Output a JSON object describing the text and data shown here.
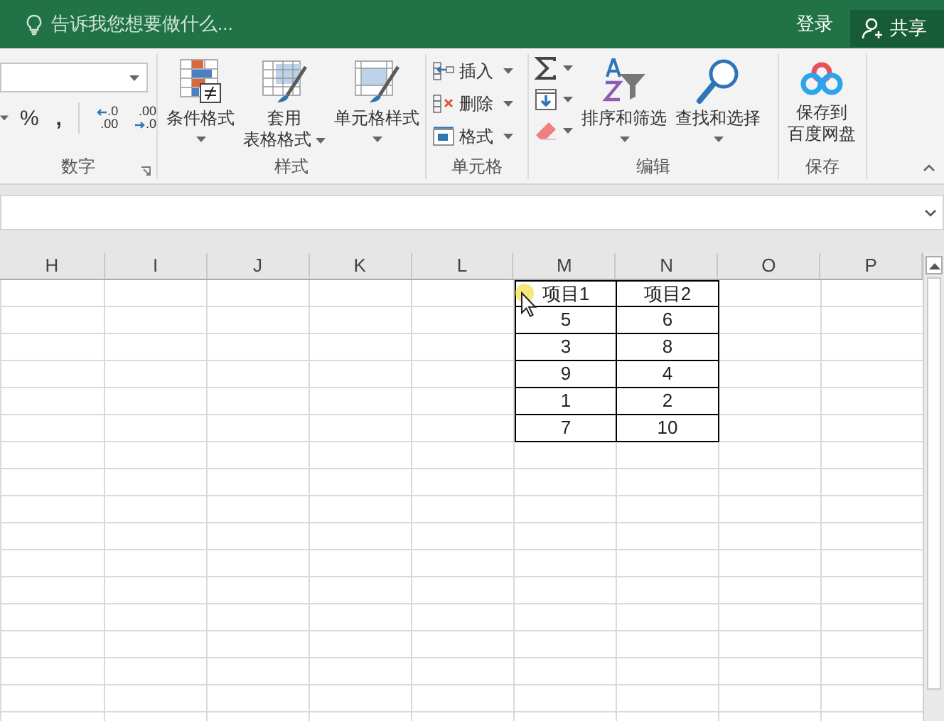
{
  "search": {
    "placeholder": "告诉我您想要做什么..."
  },
  "account": {
    "sign_in": "登录",
    "share": "共享"
  },
  "number_group": {
    "label": "数字",
    "percent": "%",
    "comma": ",",
    "decimals": [
      {
        "kind": "increase",
        "top": ".0",
        "bottom": ".00"
      },
      {
        "kind": "decrease",
        "top": ".00",
        "bottom": ".0"
      }
    ]
  },
  "styles_group": {
    "label": "样式",
    "buttons": [
      {
        "kind": "conditional",
        "lines": [
          "条件格式"
        ]
      },
      {
        "kind": "table",
        "lines": [
          "套用",
          "表格格式"
        ]
      },
      {
        "kind": "cellstyle",
        "lines": [
          "单元格样式"
        ]
      }
    ]
  },
  "cells_group": {
    "label": "单元格",
    "items": [
      {
        "kind": "insert",
        "label": "插入"
      },
      {
        "kind": "delete",
        "label": "删除"
      },
      {
        "kind": "format",
        "label": "格式"
      }
    ]
  },
  "edit_group": {
    "label": "编辑",
    "tools": [
      {
        "kind": "sum"
      },
      {
        "kind": "fill"
      },
      {
        "kind": "clear"
      }
    ],
    "buttons": [
      {
        "kind": "sort",
        "lines": [
          "排序和筛选"
        ]
      },
      {
        "kind": "find",
        "lines": [
          "查找和选择"
        ]
      }
    ]
  },
  "save_group": {
    "label": "保存",
    "buttons": [
      {
        "kind": "cloud",
        "lines": [
          "保存到",
          "百度网盘"
        ]
      }
    ]
  },
  "sheet": {
    "columns": [
      "H",
      "I",
      "J",
      "K",
      "L",
      "M",
      "N",
      "O",
      "P"
    ],
    "table": [
      [
        "项目1",
        "项目2"
      ],
      [
        "5",
        "6"
      ],
      [
        "3",
        "8"
      ],
      [
        "9",
        "4"
      ],
      [
        "1",
        "2"
      ],
      [
        "7",
        "10"
      ]
    ]
  }
}
